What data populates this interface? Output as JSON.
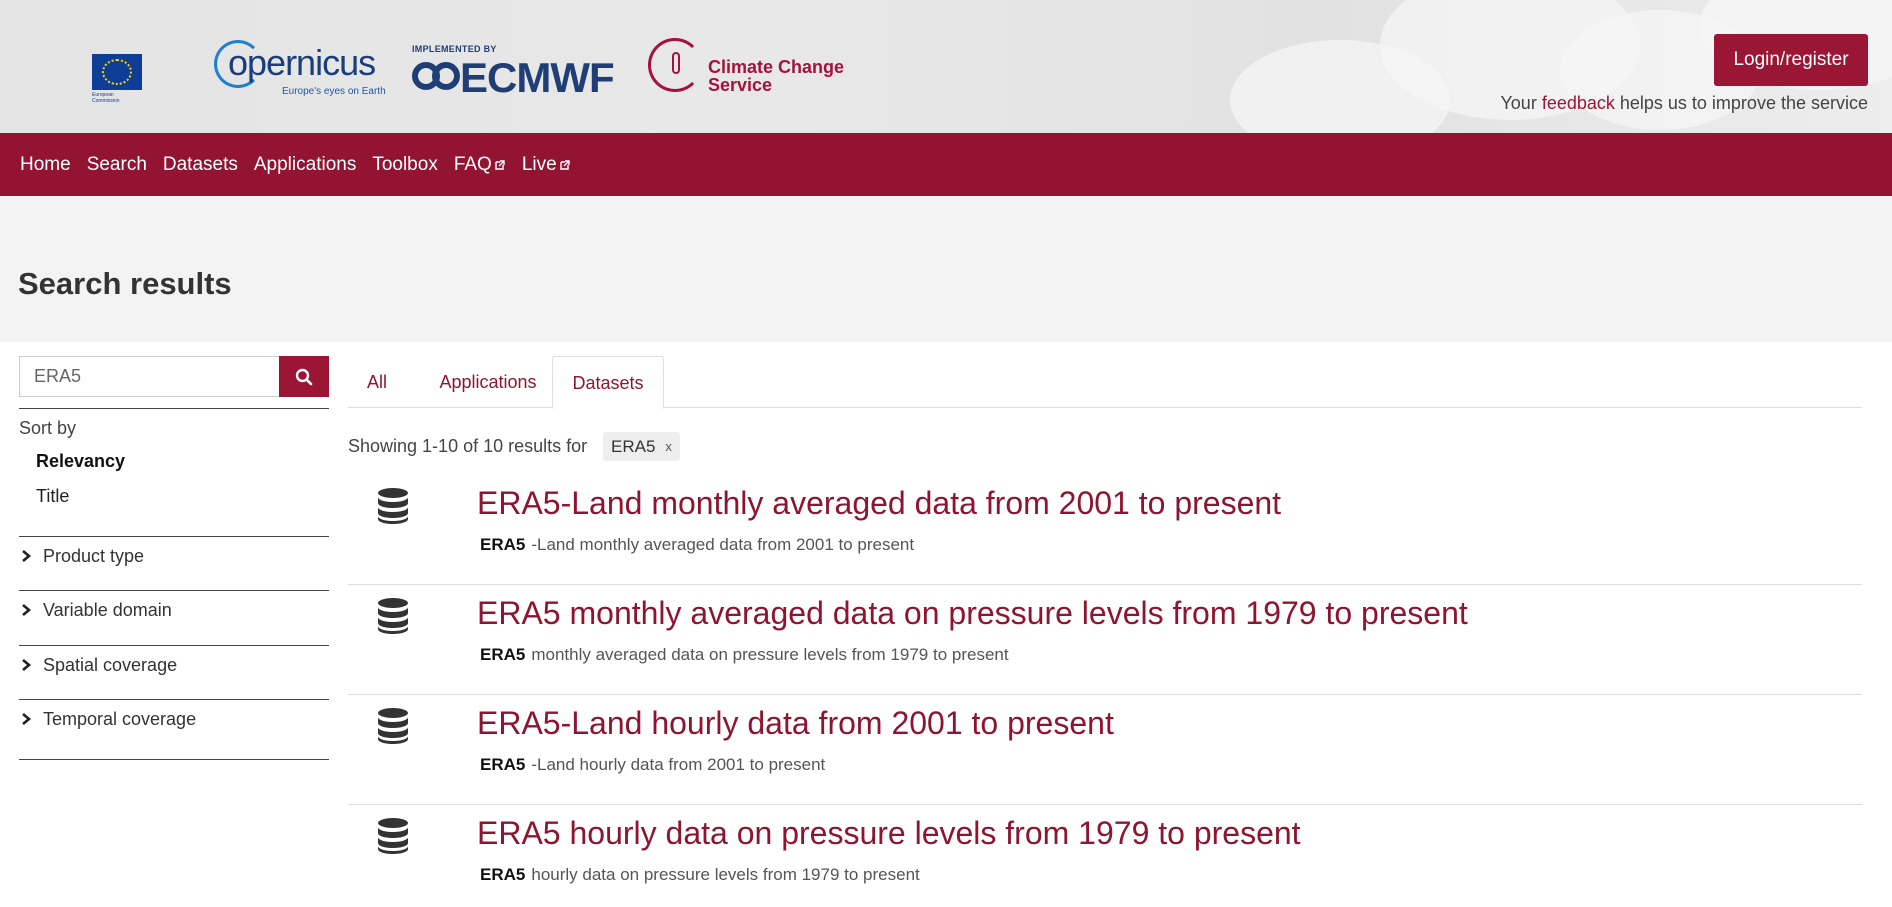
{
  "header": {
    "eu_logo_text": "European Commission",
    "copernicus_word": "opernicus",
    "copernicus_tagline": "Europe's eyes on Earth",
    "ecmwf_implemented": "IMPLEMENTED BY",
    "ecmwf_word": "ECMWF",
    "c3s_line1": "Climate Change",
    "c3s_line2": "Service",
    "login_label": "Login/register",
    "feedback_prefix": "Your ",
    "feedback_link": "feedback",
    "feedback_suffix": " helps us to improve the service"
  },
  "nav": {
    "items": [
      {
        "label": "Home"
      },
      {
        "label": "Search"
      },
      {
        "label": "Datasets"
      },
      {
        "label": "Applications"
      },
      {
        "label": "Toolbox"
      },
      {
        "label": "FAQ"
      },
      {
        "label": "Live"
      }
    ]
  },
  "page": {
    "title": "Search results"
  },
  "search": {
    "value": "ERA5",
    "icon": "search-icon"
  },
  "sort": {
    "label": "Sort by",
    "options": [
      {
        "label": "Relevancy",
        "active": true
      },
      {
        "label": "Title",
        "active": false
      }
    ]
  },
  "facets": [
    {
      "label": "Product type"
    },
    {
      "label": "Variable domain"
    },
    {
      "label": "Spatial coverage"
    },
    {
      "label": "Temporal coverage"
    }
  ],
  "tabs": [
    {
      "label": "All",
      "active": false
    },
    {
      "label": "Applications",
      "active": false
    },
    {
      "label": "Datasets",
      "active": true
    }
  ],
  "results_summary": {
    "text": "Showing 1-10 of 10 results for",
    "query": "ERA5",
    "close": "x"
  },
  "results": [
    {
      "title": "ERA5-Land monthly averaged data from 2001 to present",
      "desc_highlight": "ERA5",
      "desc_rest": "-Land monthly averaged data from 2001 to present"
    },
    {
      "title": "ERA5 monthly averaged data on pressure levels from 1979 to present",
      "desc_highlight": "ERA5",
      "desc_rest": "monthly averaged data on pressure levels from 1979 to present"
    },
    {
      "title": "ERA5-Land hourly data from 2001 to present",
      "desc_highlight": "ERA5",
      "desc_rest": "-Land hourly data from 2001 to present"
    },
    {
      "title": "ERA5 hourly data on pressure levels from 1979 to present",
      "desc_highlight": "ERA5",
      "desc_rest": "hourly data on pressure levels from 1979 to present"
    }
  ],
  "colors": {
    "brand": "#931432",
    "link": "#8e1531",
    "band": "#f3f3f3"
  }
}
